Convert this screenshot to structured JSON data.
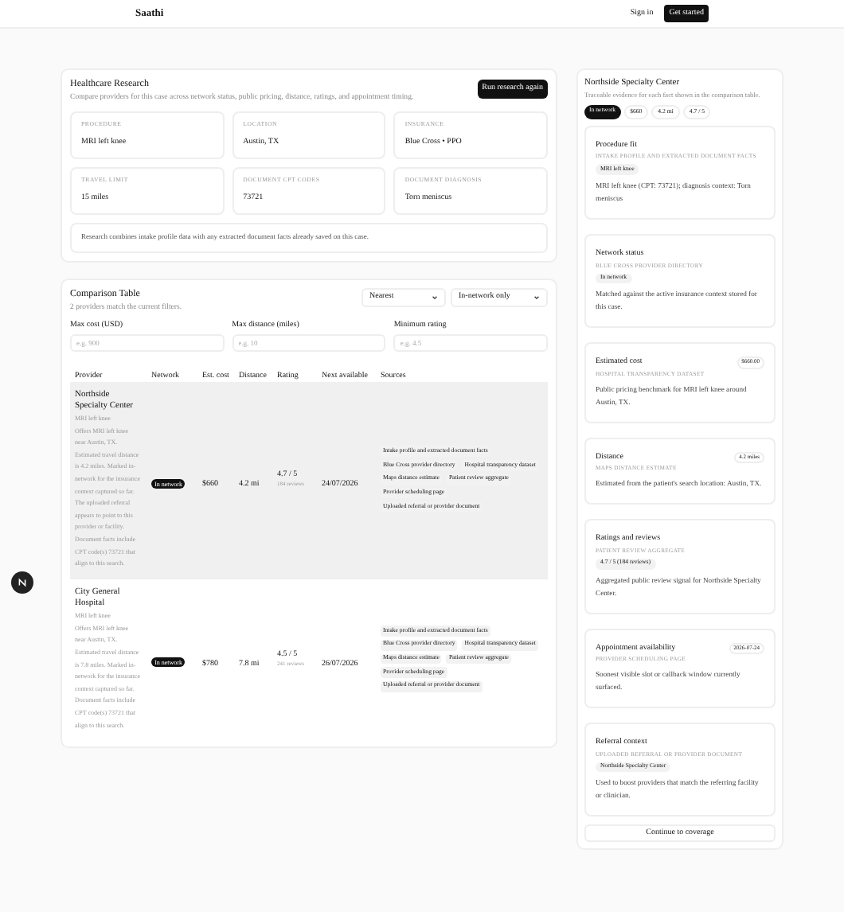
{
  "nav": {
    "brand": "Saathi",
    "sign_in": "Sign in",
    "get_started": "Get started"
  },
  "research": {
    "title": "Healthcare Research",
    "subtitle": "Compare providers for this case across network status, public pricing, distance, ratings, and appointment timing.",
    "run_button": "Run research again",
    "facts": [
      {
        "label": "PROCEDURE",
        "value": "MRI left knee"
      },
      {
        "label": "LOCATION",
        "value": "Austin, TX"
      },
      {
        "label": "INSURANCE",
        "value": "Blue Cross • PPO"
      },
      {
        "label": "TRAVEL LIMIT",
        "value": "15 miles"
      },
      {
        "label": "DOCUMENT CPT CODES",
        "value": "73721"
      },
      {
        "label": "DOCUMENT DIAGNOSIS",
        "value": "Torn meniscus"
      }
    ],
    "note": "Research combines intake profile data with any extracted document facts already saved on this case."
  },
  "comparison": {
    "title": "Comparison Table",
    "subtitle": "2 providers match the current filters.",
    "sort": "Nearest",
    "network_filter": "In-network only",
    "filters": [
      {
        "label": "Max cost (USD)",
        "placeholder": "e.g. 900"
      },
      {
        "label": "Max distance (miles)",
        "placeholder": "e.g. 10"
      },
      {
        "label": "Minimum rating",
        "placeholder": "e.g. 4.5"
      }
    ],
    "columns": [
      "Provider",
      "Network",
      "Est. cost",
      "Distance",
      "Rating",
      "Next available",
      "Sources"
    ],
    "rows": [
      {
        "name": "Northside Specialty Center",
        "procedure": "MRI left knee",
        "summary": "Offers MRI left knee near Austin, TX. Estimated travel distance is 4.2 miles. Marked in-network for the insurance context captured so far. The uploaded referral appears to point to this provider or facility. Document facts include CPT code(s) 73721 that align to this search.",
        "network": "In network",
        "cost": "$660",
        "distance": "4.2 mi",
        "rating": "4.7 / 5",
        "reviews": "184 reviews",
        "next": "24/07/2026",
        "selected": true,
        "sources": [
          "Intake profile and extracted document facts",
          "Blue Cross provider directory",
          "Hospital transparency dataset",
          "Maps distance estimate",
          "Patient review aggregate",
          "Provider scheduling page",
          "Uploaded referral or provider document"
        ]
      },
      {
        "name": "City General Hospital",
        "procedure": "MRI left knee",
        "summary": "Offers MRI left knee near Austin, TX. Estimated travel distance is 7.8 miles. Marked in-network for the insurance context captured so far. Document facts include CPT code(s) 73721 that align to this search.",
        "network": "In network",
        "cost": "$780",
        "distance": "7.8 mi",
        "rating": "4.5 / 5",
        "reviews": "241 reviews",
        "next": "26/07/2026",
        "selected": false,
        "sources": [
          "Intake profile and extracted document facts",
          "Blue Cross provider directory",
          "Hospital transparency dataset",
          "Maps distance estimate",
          "Patient review aggregate",
          "Provider scheduling page",
          "Uploaded referral or provider document"
        ]
      }
    ]
  },
  "detail": {
    "title": "Northside Specialty Center",
    "subtitle": "Traceable evidence for each fact shown in the comparison table.",
    "chips": [
      {
        "label": "In network",
        "kind": "dark"
      },
      {
        "label": "$660",
        "kind": "light"
      },
      {
        "label": "4.2 mi",
        "kind": "light"
      },
      {
        "label": "4.7 / 5",
        "kind": "light"
      }
    ],
    "evidence": [
      {
        "title": "Procedure fit",
        "source": "INTAKE PROFILE AND EXTRACTED DOCUMENT FACTS",
        "chip": "MRI left knee",
        "text": "MRI left knee (CPT: 73721); diagnosis context: Torn meniscus"
      },
      {
        "title": "Network status",
        "source": "BLUE CROSS PROVIDER DIRECTORY",
        "chip": "In network",
        "text": "Matched against the active insurance context stored for this case."
      },
      {
        "title": "Estimated cost",
        "value": "$660.00",
        "source": "HOSPITAL TRANSPARENCY DATASET",
        "text": "Public pricing benchmark for MRI left knee around Austin, TX."
      },
      {
        "title": "Distance",
        "value": "4.2 miles",
        "source": "MAPS DISTANCE ESTIMATE",
        "text": "Estimated from the patient's search location: Austin, TX."
      },
      {
        "title": "Ratings and reviews",
        "source": "PATIENT REVIEW AGGREGATE",
        "chip": "4.7 / 5 (184 reviews)",
        "text": "Aggregated public review signal for Northside Specialty Center."
      },
      {
        "title": "Appointment availability",
        "value": "2026-07-24",
        "source": "PROVIDER SCHEDULING PAGE",
        "text": "Soonest visible slot or callback window currently surfaced."
      },
      {
        "title": "Referral context",
        "source": "UPLOADED REFERRAL OR PROVIDER DOCUMENT",
        "chip": "Northside Specialty Center",
        "text": "Used to boost providers that match the referring facility or clinician."
      }
    ],
    "continue_button": "Continue to coverage"
  }
}
